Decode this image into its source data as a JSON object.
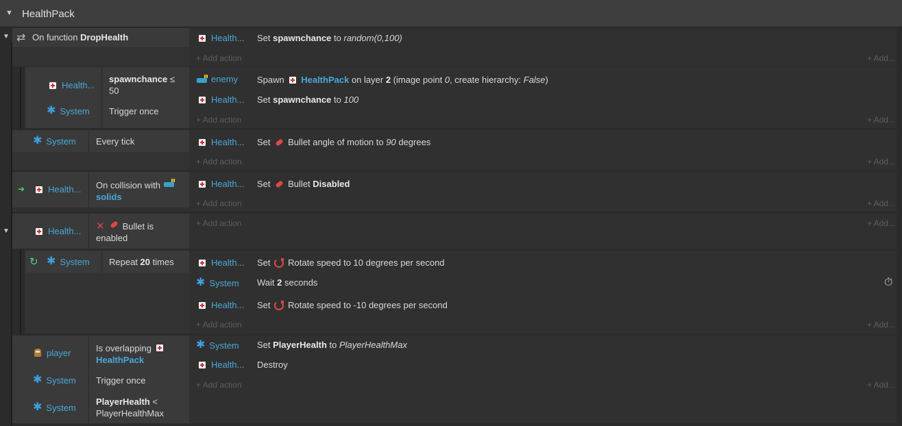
{
  "group": {
    "title": "HealthPack",
    "collapse_icon": "triangle-down-icon"
  },
  "common": {
    "add_action": "+ Add action",
    "add_more": "+ Add..."
  },
  "events": {
    "e1": {
      "function_label": "On function",
      "function_name": "DropHealth",
      "actions": [
        {
          "object": "Health...",
          "text_pre": "Set",
          "var": "spawnchance",
          "text_mid": "to",
          "value": "random(0,100)"
        }
      ]
    },
    "e2": {
      "conditions": [
        {
          "object": "Health...",
          "text": "spawnchance",
          "text_b": "≤ 50"
        },
        {
          "object": "System",
          "text": "Trigger once"
        }
      ],
      "actions": [
        {
          "object": "enemy",
          "spawn": "Spawn",
          "target": "HealthPack",
          "on_layer": "on layer",
          "layer": "2",
          "p1": "(image point",
          "point": "0",
          "p2": ", create hierarchy:",
          "hier": "False",
          "p3": ")"
        },
        {
          "object": "Health...",
          "text_pre": "Set",
          "var": "spawnchance",
          "text_mid": "to",
          "value": "100"
        }
      ]
    },
    "e3": {
      "conditions": [
        {
          "object": "System",
          "text": "Every tick"
        }
      ],
      "actions": [
        {
          "object": "Health...",
          "set": "Set",
          "behavior": "Bullet angle of motion to",
          "value": "90",
          "unit": "degrees"
        }
      ]
    },
    "e4": {
      "conditions": [
        {
          "object": "Health...",
          "text": "On collision with",
          "target": "solids"
        }
      ],
      "actions": [
        {
          "object": "Health...",
          "set": "Set",
          "behavior": "Bullet",
          "value": "Disabled"
        }
      ]
    },
    "e5": {
      "conditions": [
        {
          "object": "Health...",
          "text": "Bullet is enabled"
        }
      ]
    },
    "e6": {
      "conditions": [
        {
          "object": "System",
          "text": "Repeat",
          "count": "20",
          "suffix": "times"
        }
      ],
      "actions": [
        {
          "object": "Health...",
          "set": "Set",
          "text": "Rotate speed to 10 degrees per second"
        },
        {
          "object": "System",
          "wait": "Wait",
          "seconds": "2",
          "unit": "seconds"
        },
        {
          "object": "Health...",
          "set": "Set",
          "text": "Rotate speed to -10 degrees per second"
        }
      ]
    },
    "e7": {
      "conditions": [
        {
          "object": "player",
          "text": "Is overlapping",
          "target": "HealthPack"
        },
        {
          "object": "System",
          "text": "Trigger once"
        },
        {
          "object": "System",
          "var": "PlayerHealth",
          "op": "<",
          "value": "PlayerHealthMax"
        }
      ],
      "actions": [
        {
          "object": "System",
          "text_pre": "Set",
          "var": "PlayerHealth",
          "text_mid": "to",
          "value": "PlayerHealthMax"
        },
        {
          "object": "Health...",
          "text": "Destroy"
        }
      ]
    }
  }
}
